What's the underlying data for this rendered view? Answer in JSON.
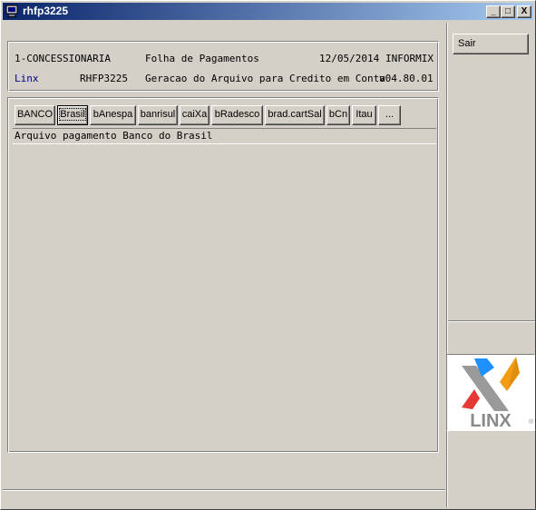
{
  "window": {
    "title": "rhfp3225",
    "controls": {
      "minimize": "_",
      "maximize": "□",
      "close": "X"
    }
  },
  "header": {
    "row1": {
      "company": "1-CONCESSIONARIA",
      "module": "Folha de Pagamentos",
      "date": "12/05/2014",
      "db": "INFORMIX"
    },
    "row2": {
      "vendor": "Linx",
      "program": "RHFP3225",
      "description": "Geracao do Arquivo para Credito em Conta",
      "version": "v04.80.01"
    }
  },
  "tabs": [
    {
      "label": "BANCO"
    },
    {
      "label": "Brasil"
    },
    {
      "label": "bAnespa"
    },
    {
      "label": "banrisul"
    },
    {
      "label": "caiXa"
    },
    {
      "label": "bRadesco"
    },
    {
      "label": "brad.cartSal"
    },
    {
      "label": "bCn"
    },
    {
      "label": "Itau"
    },
    {
      "label": "..."
    }
  ],
  "active_tab": "Brasil",
  "description_bar": "Arquivo pagamento Banco do Brasil",
  "actions": {
    "sair": "Sair"
  },
  "logo": {
    "text": "LINX",
    "registered": "®"
  },
  "colors": {
    "titlebar_start": "#0a246a",
    "titlebar_end": "#a6caf0",
    "vendor_text": "#000080",
    "face": "#d4d0c8"
  }
}
